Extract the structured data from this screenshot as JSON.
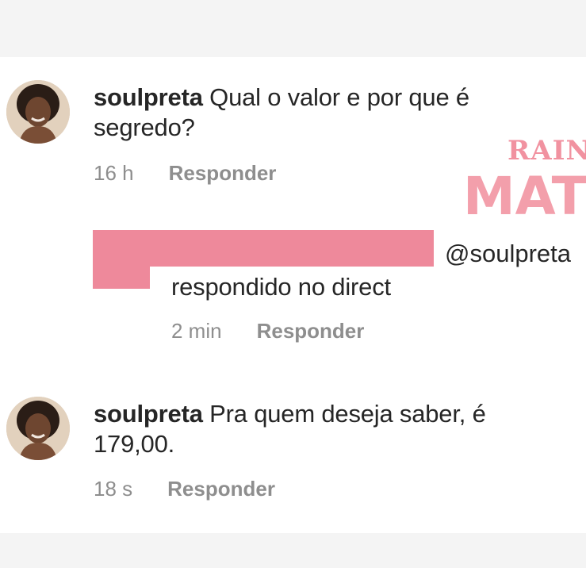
{
  "watermark": {
    "line1": "RAIN",
    "line2": "MAT"
  },
  "comments": [
    {
      "username": "soulpreta",
      "text_line1": "Qual o valor e por que é",
      "text_line2": "segredo?",
      "time": "16 h",
      "reply_label": "Responder"
    },
    {
      "mention": "@soulpreta",
      "text": "respondido no direct",
      "time": "2 min",
      "reply_label": "Responder"
    },
    {
      "username": "soulpreta",
      "text_line1": "Pra quem deseja saber, é",
      "text_line2": "179,00.",
      "time": "18 s",
      "reply_label": "Responder"
    }
  ],
  "colors": {
    "redaction": "#ee899b",
    "watermark": "#ef7f90",
    "meta_text": "#8e8e8e"
  }
}
